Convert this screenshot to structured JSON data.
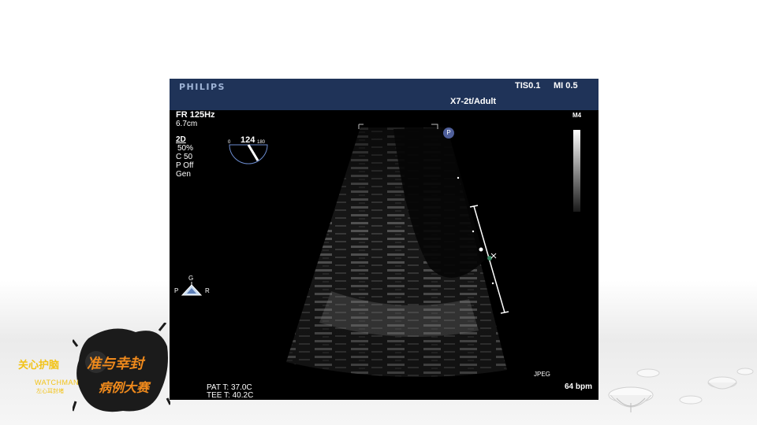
{
  "header": {
    "brand": "PHILIPS",
    "tis": "TIS0.1",
    "mi": "MI 0.5",
    "probe": "X7-2t/Adult"
  },
  "params": {
    "fr": "FR 125Hz",
    "depth": "6.7cm",
    "mode": "2D",
    "gain": "50%",
    "compress": "C 50",
    "persistence": "P Off",
    "general": "Gen"
  },
  "angle": {
    "value": "124",
    "min": "0",
    "max": "180"
  },
  "marker": "P",
  "scale_label": "M4",
  "orientation": {
    "top": "G",
    "left": "P",
    "right": "R"
  },
  "footer": {
    "pat_t": "PAT T: 37.0C",
    "tee_t": "TEE T: 40.2C",
    "format": "JPEG",
    "heart_rate": "64 bpm"
  },
  "logo": {
    "slogan_left": "关心护脑",
    "slogan_right": "准与幸封",
    "brand": "WATCHMAN",
    "brand_cn": "左心耳封堵",
    "contest": "病例大赛"
  },
  "colors": {
    "header_bg": "#1f3358",
    "logo_yellow": "#f2c318",
    "logo_orange": "#f08a1c"
  }
}
